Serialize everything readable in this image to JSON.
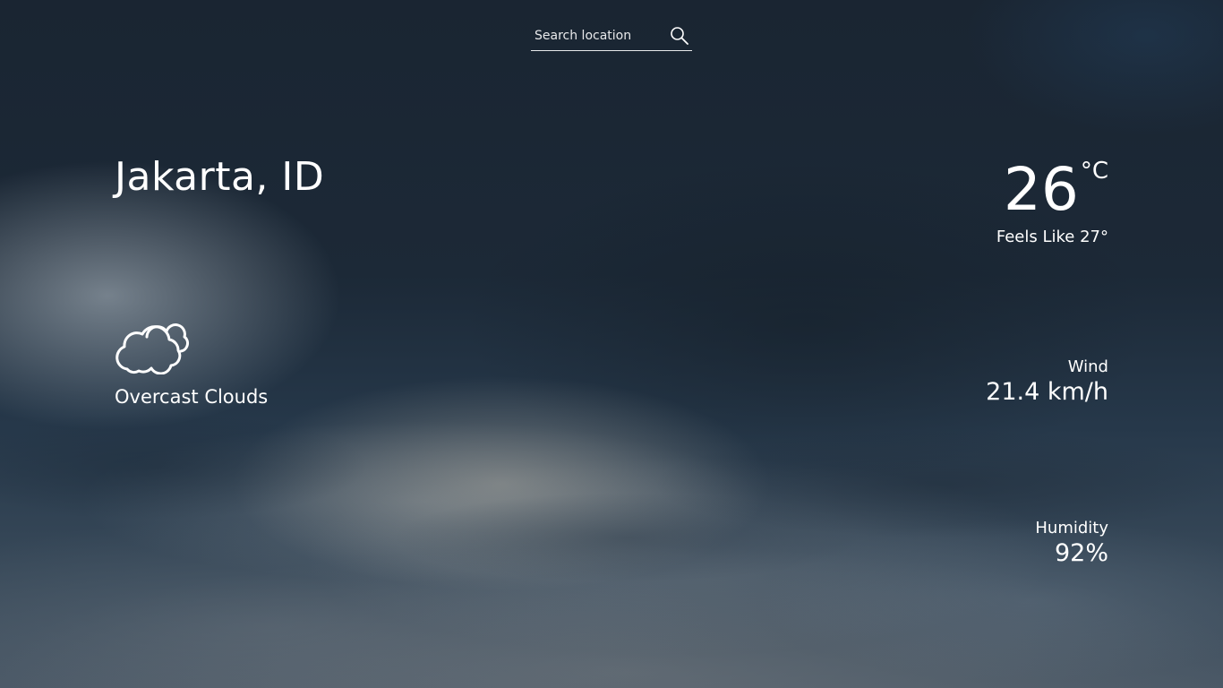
{
  "search": {
    "placeholder": "Search location",
    "icon": "search-icon"
  },
  "location": {
    "name": "Jakarta, ID"
  },
  "condition": {
    "icon": "cloud-icon",
    "label": "Overcast Clouds"
  },
  "temperature": {
    "value": "26",
    "unit": "°C",
    "feels_like": "Feels Like 27°"
  },
  "wind": {
    "label": "Wind",
    "value": "21.4 km/h"
  },
  "humidity": {
    "label": "Humidity",
    "value": "92%"
  },
  "colors": {
    "text": "#ffffff",
    "sky_dark": "#1a2532"
  }
}
